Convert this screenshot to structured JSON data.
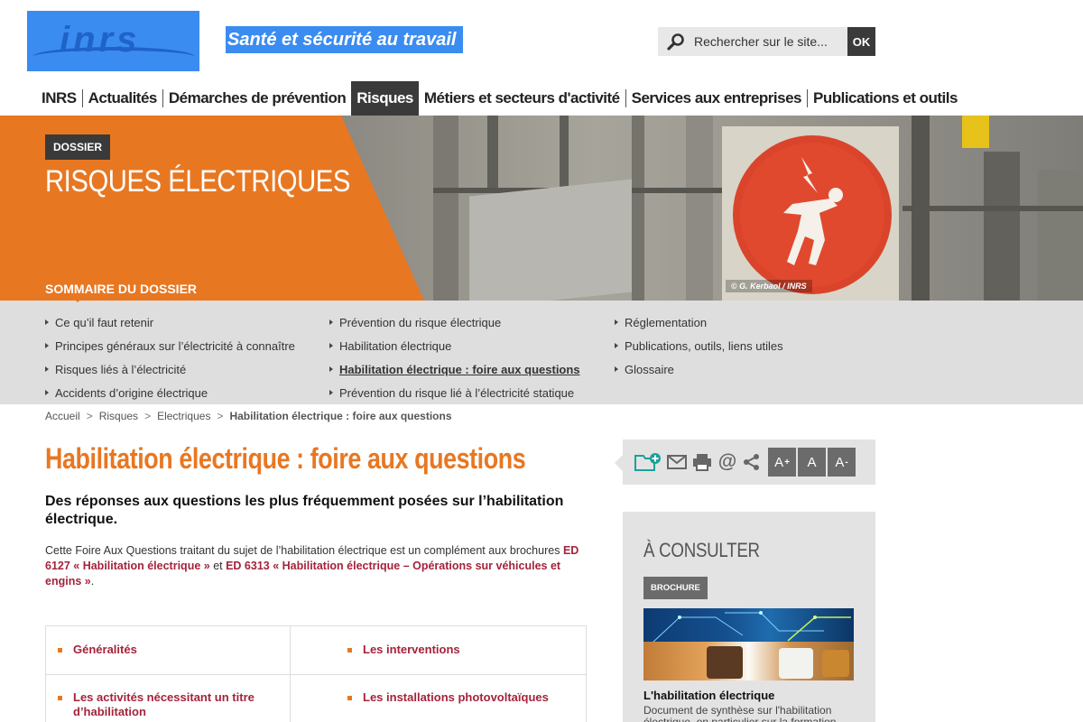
{
  "header": {
    "logo_text": "inrs",
    "tagline": "Santé et sécurité au travail",
    "search_placeholder": "Rechercher sur le site...",
    "search_button": "OK"
  },
  "nav": {
    "items": [
      {
        "label": "INRS"
      },
      {
        "label": "Actualités"
      },
      {
        "label": "Démarches de prévention"
      },
      {
        "label": "Risques",
        "active": true
      },
      {
        "label": "Métiers et secteurs d'activité"
      },
      {
        "label": "Services aux entreprises"
      },
      {
        "label": "Publications et outils"
      }
    ]
  },
  "hero": {
    "badge": "DOSSIER",
    "title": "RISQUES ÉLECTRIQUES",
    "photo_credit": "© G. Kerbaol / INRS",
    "accent_color": "#e87722"
  },
  "summary": {
    "title": "SOMMAIRE DU DOSSIER",
    "col1": [
      "Ce qu’il faut retenir",
      "Principes généraux sur l’électricité à connaître",
      "Risques liés à l’électricité",
      "Accidents d’origine électrique"
    ],
    "col2": [
      "Prévention du risque électrique",
      "Habilitation électrique",
      "Habilitation électrique : foire aux questions",
      "Prévention du risque lié à l’électricité statique"
    ],
    "col3": [
      "Réglementation",
      "Publications, outils, liens utiles",
      "Glossaire"
    ]
  },
  "breadcrumb": {
    "items": [
      "Accueil",
      "Risques",
      "Electriques"
    ],
    "separator": ">",
    "current": "Habilitation électrique : foire aux questions"
  },
  "main": {
    "title": "Habilitation électrique : foire aux questions",
    "lead": "Des réponses aux questions les plus fréquemment posées sur l’habilitation électrique.",
    "intro_text": "Cette Foire Aux Questions traitant du sujet de l’habilitation électrique est un complément aux  brochures ",
    "intro_link1": "ED 6127 « Habilitation électrique »",
    "intro_and": " et ",
    "intro_link2": "ED 6313 « Habilitation électrique – Opérations sur véhicules et engins »",
    "intro_end": ".",
    "faq": {
      "c1": "Généralités",
      "c2": "Les interventions",
      "c3": "Les activités nécessitant un titre d’habilitation",
      "c4": "Les installations photovoltaïques"
    }
  },
  "toolbar": {
    "font_increase": "A",
    "font_increase_sup": "+",
    "font_reset": "A",
    "font_decrease": "A",
    "font_decrease_sup": "-"
  },
  "aside": {
    "title": "À CONSULTER",
    "badge": "BROCHURE",
    "item_title": "L'habilitation électrique",
    "item_desc": "Document de synthèse sur l'habilitation électrique, en particulier sur la formation"
  }
}
